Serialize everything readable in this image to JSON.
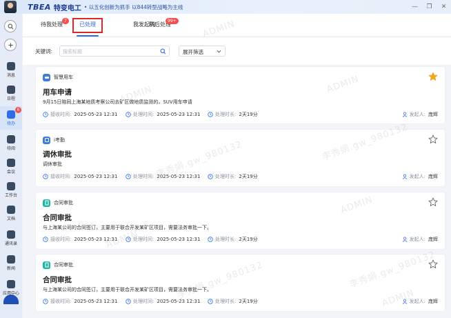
{
  "app": {
    "logo_text": "TBEA",
    "logo_cn": "特变电工",
    "slogan": "• 以五化创新为抓手 以844转型战略为主线"
  },
  "window_controls": [
    "—",
    "❐",
    "✕"
  ],
  "sidebar": {
    "items": [
      {
        "label": "消息",
        "icon": "message-icon"
      },
      {
        "label": "日程",
        "icon": "calendar-icon"
      },
      {
        "label": "待办",
        "icon": "todo-icon",
        "badge": "6",
        "active": true
      },
      {
        "label": "待阅",
        "icon": "read-icon"
      },
      {
        "label": "会议",
        "icon": "meeting-icon"
      },
      {
        "label": "工作台",
        "icon": "workbench-icon"
      },
      {
        "label": "文档",
        "icon": "document-icon"
      },
      {
        "label": "通讯录",
        "icon": "contacts-icon"
      },
      {
        "label": "新闻",
        "icon": "news-icon"
      },
      {
        "label": "应用中心",
        "icon": "app-center-icon"
      }
    ]
  },
  "tabs": [
    {
      "label": "待我处理",
      "badge": "7"
    },
    {
      "label": "已处理",
      "active": true
    },
    {
      "label": "我发起的"
    },
    {
      "label": "稍后处理",
      "badge": "99+"
    }
  ],
  "filter": {
    "keyword_label": "关键词:",
    "search_placeholder": "搜索标题",
    "expand_label": "展开筛选"
  },
  "meta_labels": {
    "received": "接收时间:",
    "processed": "处理时间:",
    "duration": "处理时长:",
    "initiator": "发起人:"
  },
  "cards": [
    {
      "app": "智慧用车",
      "app_color": "#3f7bd9",
      "starred": true,
      "title": "用车申请",
      "desc": "9月15日陪同上海某地质考察公司去矿区做地质监测的，SUV用车申请",
      "received": "2025-05-23 12:31",
      "processed": "2025-05-23 12:31",
      "duration": "2天19分",
      "initiator": "庞辉"
    },
    {
      "app": "i考勤",
      "app_color": "#3f7bd9",
      "starred": false,
      "title": "调休审批",
      "desc": "调休审批",
      "received": "2025-05-23 12:31",
      "processed": "2025-05-23 12:31",
      "duration": "2天19分",
      "initiator": "庞辉"
    },
    {
      "app": "合同审批",
      "app_color": "#25b5a6",
      "starred": false,
      "title": "合同审批",
      "desc": "与上海某公司的合同签订，主要用于联合开发某矿区项目，需要法务审批一下。",
      "received": "2025-05-23 12:31",
      "processed": "2025-05-23 12:31",
      "duration": "2天19分",
      "initiator": "庞辉"
    },
    {
      "app": "合同审批",
      "app_color": "#25b5a6",
      "starred": false,
      "title": "合同审批",
      "desc": "与上海某公司的合同签订，主要用于联合开发某矿区项目，需要法务审批一下。",
      "received": "2025-05-23 12:31",
      "processed": "2025-05-23 12:31",
      "duration": "2天19分",
      "initiator": "庞辉"
    }
  ],
  "watermark": {
    "user": "李秀娟.gw_980132",
    "mark": "ADMIN"
  },
  "colors": {
    "accent": "#2f6de6",
    "badge": "#f5504d",
    "star": "#f2a623",
    "highlight_box": "#e3242b"
  }
}
